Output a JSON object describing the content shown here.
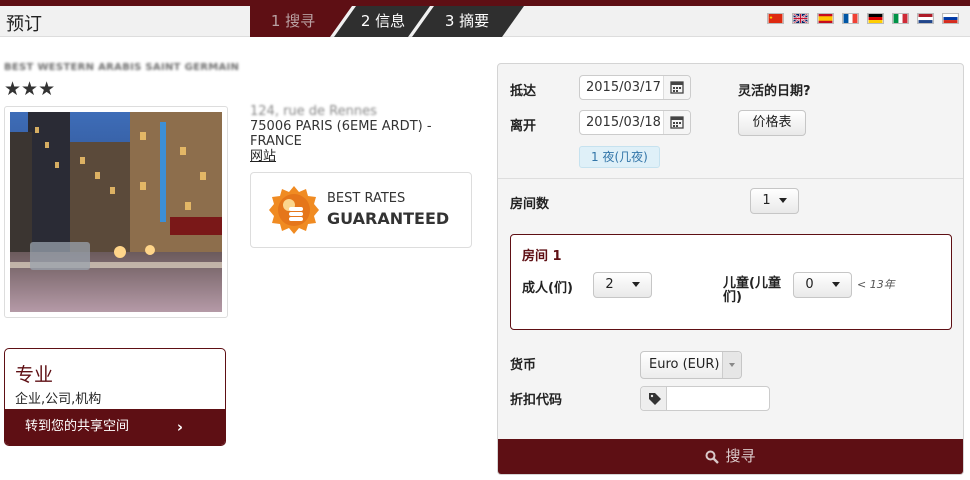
{
  "header": {
    "title": "预订",
    "steps": [
      {
        "label": "1 搜寻"
      },
      {
        "label": "2 信息"
      },
      {
        "label": "3 摘要"
      }
    ],
    "flags": [
      {
        "name": "chinese-flag-icon",
        "color": "#de2910"
      },
      {
        "name": "british-flag-icon",
        "color": "#012169"
      },
      {
        "name": "spanish-flag-icon",
        "color": "#c60b1e"
      },
      {
        "name": "french-flag-icon",
        "color": "#0055a4"
      },
      {
        "name": "german-flag-icon",
        "color": "#000000"
      },
      {
        "name": "italian-flag-icon",
        "color": "#009246"
      },
      {
        "name": "dutch-flag-icon",
        "color": "#ae1c28"
      },
      {
        "name": "russian-flag-icon",
        "color": "#0039a6"
      }
    ]
  },
  "hotel": {
    "name": "BEST WESTERN ARABIS SAINT GERMAIN",
    "stars": "★★★",
    "street": "124, rue de Rennes",
    "city": "75006 PARIS (6EME ARDT) -",
    "country": "FRANCE",
    "website": "网站"
  },
  "badge": {
    "line1": "BEST RATES",
    "line2": "GUARANTEED"
  },
  "pro": {
    "title": "专业",
    "subtitle": "企业,公司,机构",
    "button": "转到您的共享空间"
  },
  "booking": {
    "arrival_label": "抵达",
    "arrival_value": "2015/03/17",
    "departure_label": "离开",
    "departure_value": "2015/03/18",
    "flexible_label": "灵活的日期?",
    "rates_button": "价格表",
    "nights": "1 夜(几夜)",
    "rooms_label": "房间数",
    "rooms_value": "1",
    "room": {
      "title": "房间 1",
      "adults_label": "成人(们)",
      "adults_value": "2",
      "children_label": "儿童(儿童们)",
      "children_value": "0",
      "age_note": "< 13年"
    },
    "currency_label": "货币",
    "currency_value": "Euro (EUR)",
    "promo_label": "折扣代码",
    "promo_value": "",
    "search_button": "搜寻"
  },
  "colors": {
    "brand": "#5e0f14",
    "dark_step": "#2f2f2f"
  }
}
